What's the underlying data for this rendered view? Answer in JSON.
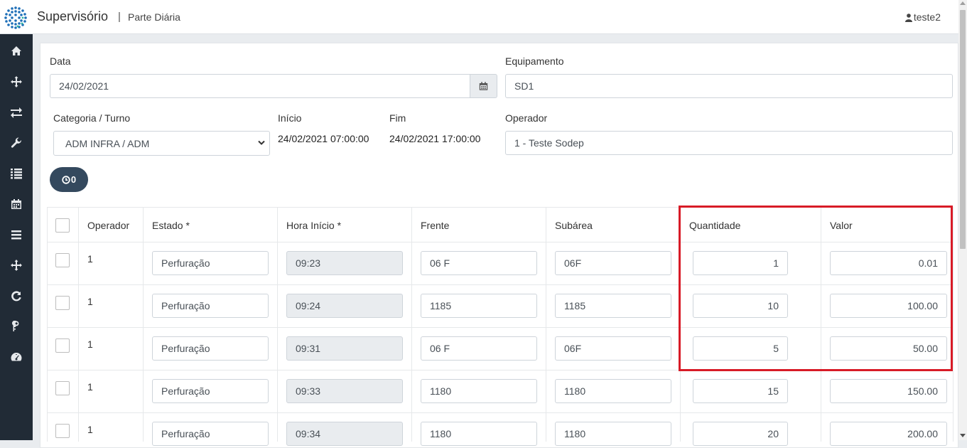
{
  "header": {
    "app_title": "Supervisório",
    "separator": "|",
    "page_title": "Parte Diária",
    "user": "teste2"
  },
  "sidebar": {
    "items": [
      "home-icon",
      "crosshair-icon",
      "exchange-icon",
      "wrench-icon",
      "list-icon",
      "calendar-icon",
      "menu-icon",
      "crosshair-icon",
      "refresh-icon",
      "key-icon",
      "dashboard-icon"
    ]
  },
  "form": {
    "data_label": "Data",
    "data_value": "24/02/2021",
    "equip_label": "Equipamento",
    "equip_value": "SD1",
    "cat_label": "Categoria / Turno",
    "cat_value": "ADM INFRA / ADM",
    "inicio_label": "Início",
    "inicio_value": "24/02/2021 07:00:00",
    "fim_label": "Fim",
    "fim_value": "24/02/2021 17:00:00",
    "operador_label": "Operador",
    "operador_value": "1 - Teste Sodep",
    "counter": "0"
  },
  "table": {
    "headers": [
      "Operador",
      "Estado *",
      "Hora Início *",
      "Frente",
      "Subárea",
      "Quantidade",
      "Valor"
    ],
    "rows": [
      {
        "operador": "1",
        "estado": "Perfuração",
        "hora": "09:23",
        "frente": "06 F",
        "subarea": "06F",
        "quantidade": "1",
        "valor": "0.01"
      },
      {
        "operador": "1",
        "estado": "Perfuração",
        "hora": "09:24",
        "frente": "1185",
        "subarea": "1185",
        "quantidade": "10",
        "valor": "100.00"
      },
      {
        "operador": "1",
        "estado": "Perfuração",
        "hora": "09:31",
        "frente": "06 F",
        "subarea": "06F",
        "quantidade": "5",
        "valor": "50.00"
      },
      {
        "operador": "1",
        "estado": "Perfuração",
        "hora": "09:33",
        "frente": "1180",
        "subarea": "1180",
        "quantidade": "15",
        "valor": "150.00"
      },
      {
        "operador": "1",
        "estado": "Perfuração",
        "hora": "09:34",
        "frente": "1180",
        "subarea": "1180",
        "quantidade": "20",
        "valor": "200.00"
      }
    ]
  },
  "colors": {
    "sidebar_bg": "#212b36",
    "pill_bg": "#34495e",
    "highlight": "#d81b27"
  }
}
